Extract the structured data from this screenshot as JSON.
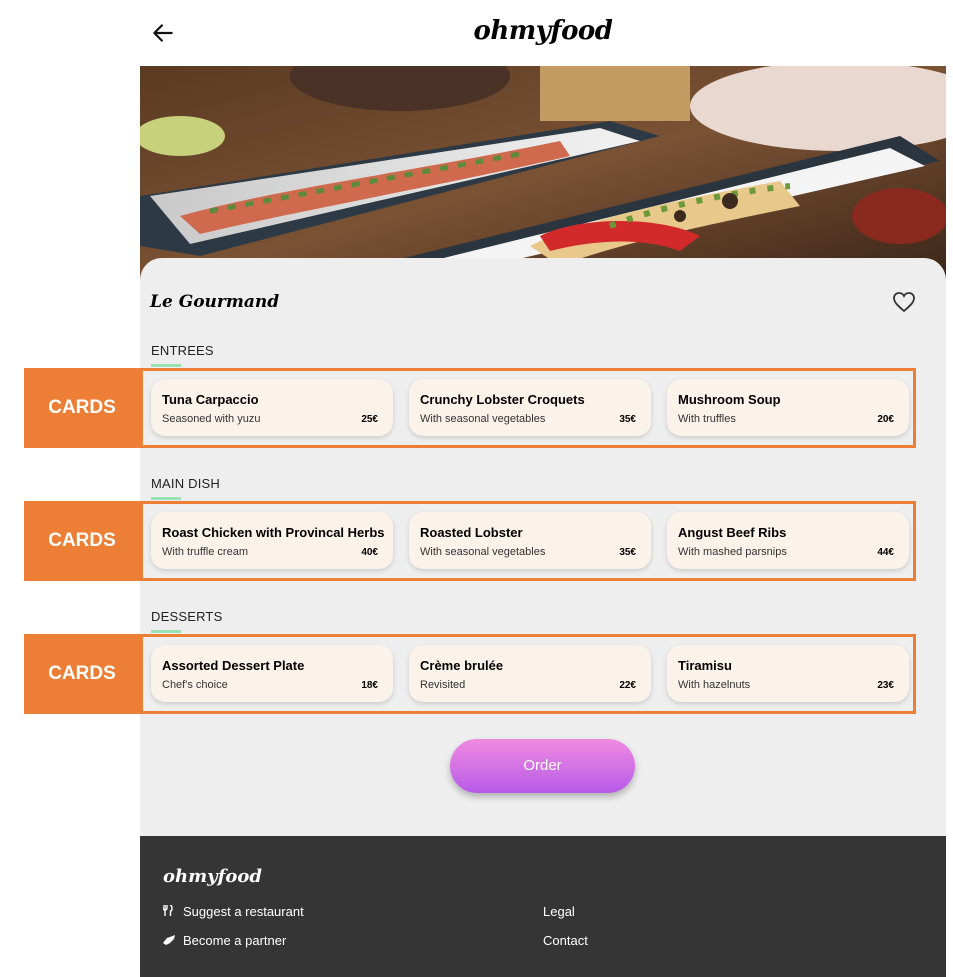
{
  "header": {
    "logo": "ohmyfood",
    "back_icon": "arrow-left-icon"
  },
  "restaurant": {
    "name": "Le Gourmand",
    "favorite_icon": "heart-outline-icon"
  },
  "menu": {
    "sections": [
      {
        "title": "ENTREES",
        "items": [
          {
            "title": "Tuna Carpaccio",
            "desc": "Seasoned with yuzu",
            "price": "25€"
          },
          {
            "title": "Crunchy Lobster Croquets",
            "desc": "With seasonal vegetables",
            "price": "35€"
          },
          {
            "title": "Mushroom Soup",
            "desc": "With truffles",
            "price": "20€"
          }
        ]
      },
      {
        "title": "MAIN DISH",
        "items": [
          {
            "title": "Roast Chicken with Provincal Herbs",
            "desc": "With truffle cream",
            "price": "40€"
          },
          {
            "title": "Roasted Lobster",
            "desc": "With seasonal vegetables",
            "price": "35€"
          },
          {
            "title": "Angust Beef Ribs",
            "desc": "With mashed parsnips",
            "price": "44€"
          }
        ]
      },
      {
        "title": "DESSERTS",
        "items": [
          {
            "title": "Assorted Dessert Plate",
            "desc": "Chef's choice",
            "price": "18€"
          },
          {
            "title": "Crème brulée",
            "desc": "Revisited",
            "price": "22€"
          },
          {
            "title": "Tiramisu",
            "desc": "With hazelnuts",
            "price": "23€"
          }
        ]
      }
    ]
  },
  "order_button": "Order",
  "footer": {
    "logo": "ohmyfood",
    "links": {
      "suggest": "Suggest a restaurant",
      "partner": "Become a partner",
      "legal": "Legal",
      "contact": "Contact"
    },
    "icons": {
      "suggest": "utensils-icon",
      "partner": "handshake-icon"
    }
  },
  "annotations": {
    "label": "CARDS"
  },
  "colors": {
    "annotation": "#ec7f35",
    "card_bg": "#fbf2ea",
    "section_accent": "#99e2b4",
    "footer_bg": "#353535",
    "order_gradient": [
      "#f08be0",
      "#b75be8"
    ]
  }
}
